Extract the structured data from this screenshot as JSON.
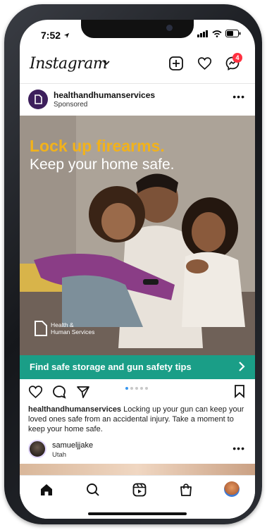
{
  "status_bar": {
    "time": "7:52"
  },
  "header": {
    "logo": "Instagram",
    "notification_count": "4"
  },
  "post": {
    "account": "healthandhumanservices",
    "sponsored_label": "Sponsored",
    "ad": {
      "headline_1": "Lock up firearms.",
      "headline_2": "Keep your home safe.",
      "brand_line_1": "Health &",
      "brand_line_2": "Human Services"
    },
    "cta_label": "Find safe storage and gun safety tips",
    "caption_user": "healthandhumanservices",
    "caption_text": " Locking up your gun can keep your loved ones safe from an accidental injury. Take a moment to keep your home safe."
  },
  "next_post": {
    "username": "samueljjake",
    "location": "Utah"
  },
  "colors": {
    "cta": "#1a9e87",
    "headline_yellow": "#f2b21b",
    "badge": "#ff3040"
  },
  "icons": [
    "back-arrow-icon",
    "new-post-icon",
    "heart-icon",
    "messenger-icon",
    "like-icon",
    "comment-icon",
    "share-icon",
    "bookmark-icon",
    "home-icon",
    "search-icon",
    "reels-icon",
    "shop-icon",
    "profile-icon"
  ]
}
